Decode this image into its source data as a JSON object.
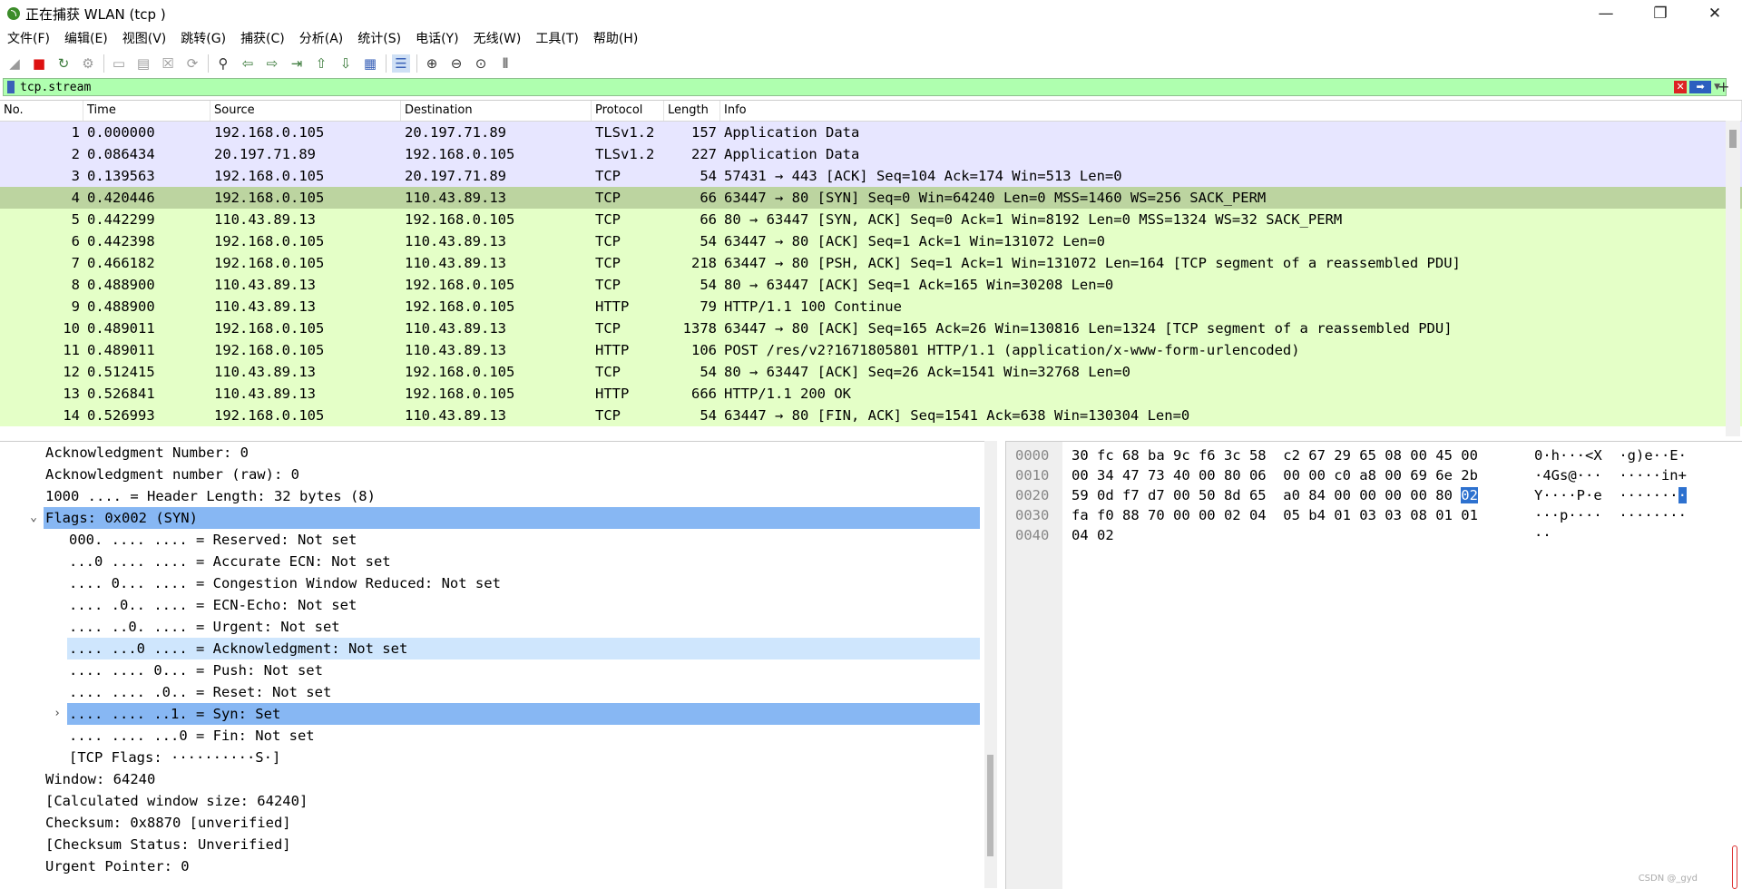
{
  "window": {
    "title": "正在捕获 WLAN (tcp )",
    "minimize_glyph": "—",
    "maximize_glyph": "❐",
    "close_glyph": "✕"
  },
  "menu": [
    "文件(F)",
    "编辑(E)",
    "视图(V)",
    "跳转(G)",
    "捕获(C)",
    "分析(A)",
    "统计(S)",
    "电话(Y)",
    "无线(W)",
    "工具(T)",
    "帮助(H)"
  ],
  "toolbar": {
    "icons": [
      "shark-fin-start-icon",
      "stop-capture-icon",
      "restart-capture-icon",
      "capture-options-icon",
      "open-file-icon",
      "save-file-icon",
      "close-file-icon",
      "reload-file-icon",
      "find-packet-icon",
      "go-back-icon",
      "go-forward-icon",
      "go-to-packet-icon",
      "go-first-icon",
      "go-last-icon",
      "auto-scroll-icon",
      "colorize-icon",
      "zoom-in-icon",
      "zoom-out-icon",
      "zoom-normal-icon",
      "resize-columns-icon"
    ]
  },
  "filter": {
    "value": "tcp.stream",
    "clear_glyph": "✕",
    "apply_glyph": "➡",
    "dropdown_glyph": "▼",
    "add_glyph": "+"
  },
  "packet_list": {
    "columns": [
      "No.",
      "Time",
      "Source",
      "Destination",
      "Protocol",
      "Length",
      "Info"
    ],
    "rows": [
      {
        "no": "1",
        "time": "0.000000",
        "src": "192.168.0.105",
        "dst": "20.197.71.89",
        "proto": "TLSv1.2",
        "len": "157",
        "info": "Application Data",
        "style": "tls"
      },
      {
        "no": "2",
        "time": "0.086434",
        "src": "20.197.71.89",
        "dst": "192.168.0.105",
        "proto": "TLSv1.2",
        "len": "227",
        "info": "Application Data",
        "style": "tls"
      },
      {
        "no": "3",
        "time": "0.139563",
        "src": "192.168.0.105",
        "dst": "20.197.71.89",
        "proto": "TCP",
        "len": "54",
        "info": "57431 → 443 [ACK] Seq=104 Ack=174 Win=513 Len=0",
        "style": "tls"
      },
      {
        "no": "4",
        "time": "0.420446",
        "src": "192.168.0.105",
        "dst": "110.43.89.13",
        "proto": "TCP",
        "len": "66",
        "info": "63447 → 80 [SYN] Seq=0 Win=64240 Len=0 MSS=1460 WS=256 SACK_PERM",
        "style": "sel"
      },
      {
        "no": "5",
        "time": "0.442299",
        "src": "110.43.89.13",
        "dst": "192.168.0.105",
        "proto": "TCP",
        "len": "66",
        "info": "80 → 63447 [SYN, ACK] Seq=0 Ack=1 Win=8192 Len=0 MSS=1324 WS=32 SACK_PERM",
        "style": "tcp"
      },
      {
        "no": "6",
        "time": "0.442398",
        "src": "192.168.0.105",
        "dst": "110.43.89.13",
        "proto": "TCP",
        "len": "54",
        "info": "63447 → 80 [ACK] Seq=1 Ack=1 Win=131072 Len=0",
        "style": "tcp"
      },
      {
        "no": "7",
        "time": "0.466182",
        "src": "192.168.0.105",
        "dst": "110.43.89.13",
        "proto": "TCP",
        "len": "218",
        "info": "63447 → 80 [PSH, ACK] Seq=1 Ack=1 Win=131072 Len=164 [TCP segment of a reassembled PDU]",
        "style": "tcp"
      },
      {
        "no": "8",
        "time": "0.488900",
        "src": "110.43.89.13",
        "dst": "192.168.0.105",
        "proto": "TCP",
        "len": "54",
        "info": "80 → 63447 [ACK] Seq=1 Ack=165 Win=30208 Len=0",
        "style": "tcp"
      },
      {
        "no": "9",
        "time": "0.488900",
        "src": "110.43.89.13",
        "dst": "192.168.0.105",
        "proto": "HTTP",
        "len": "79",
        "info": "HTTP/1.1 100 Continue",
        "style": "tcp"
      },
      {
        "no": "10",
        "time": "0.489011",
        "src": "192.168.0.105",
        "dst": "110.43.89.13",
        "proto": "TCP",
        "len": "1378",
        "info": "63447 → 80 [ACK] Seq=165 Ack=26 Win=130816 Len=1324 [TCP segment of a reassembled PDU]",
        "style": "tcp"
      },
      {
        "no": "11",
        "time": "0.489011",
        "src": "192.168.0.105",
        "dst": "110.43.89.13",
        "proto": "HTTP",
        "len": "106",
        "info": "POST /res/v2?1671805801 HTTP/1.1  (application/x-www-form-urlencoded)",
        "style": "tcp"
      },
      {
        "no": "12",
        "time": "0.512415",
        "src": "110.43.89.13",
        "dst": "192.168.0.105",
        "proto": "TCP",
        "len": "54",
        "info": "80 → 63447 [ACK] Seq=26 Ack=1541 Win=32768 Len=0",
        "style": "tcp"
      },
      {
        "no": "13",
        "time": "0.526841",
        "src": "110.43.89.13",
        "dst": "192.168.0.105",
        "proto": "HTTP",
        "len": "666",
        "info": "HTTP/1.1 200 OK",
        "style": "tcp"
      },
      {
        "no": "14",
        "time": "0.526993",
        "src": "192.168.0.105",
        "dst": "110.43.89.13",
        "proto": "TCP",
        "len": "54",
        "info": "63447 → 80 [FIN, ACK] Seq=1541 Ack=638 Win=130304 Len=0",
        "style": "tcp"
      }
    ]
  },
  "details": {
    "lines": [
      {
        "text": "Acknowledgment Number: 0",
        "indent": 0,
        "hl": ""
      },
      {
        "text": "Acknowledgment number (raw): 0",
        "indent": 0,
        "hl": ""
      },
      {
        "text": "1000 .... = Header Length: 32 bytes (8)",
        "indent": 0,
        "hl": ""
      },
      {
        "text": "Flags: 0x002 (SYN)",
        "indent": 0,
        "hl": "strong",
        "expander": "⌄"
      },
      {
        "text": "000. .... .... = Reserved: Not set",
        "indent": 1,
        "hl": ""
      },
      {
        "text": "...0 .... .... = Accurate ECN: Not set",
        "indent": 1,
        "hl": ""
      },
      {
        "text": ".... 0... .... = Congestion Window Reduced: Not set",
        "indent": 1,
        "hl": ""
      },
      {
        "text": ".... .0.. .... = ECN-Echo: Not set",
        "indent": 1,
        "hl": ""
      },
      {
        "text": ".... ..0. .... = Urgent: Not set",
        "indent": 1,
        "hl": ""
      },
      {
        "text": ".... ...0 .... = Acknowledgment: Not set",
        "indent": 1,
        "hl": "light"
      },
      {
        "text": ".... .... 0... = Push: Not set",
        "indent": 1,
        "hl": ""
      },
      {
        "text": ".... .... .0.. = Reset: Not set",
        "indent": 1,
        "hl": ""
      },
      {
        "text": ".... .... ..1. = Syn: Set",
        "indent": 1,
        "hl": "strong",
        "expander": "›"
      },
      {
        "text": ".... .... ...0 = Fin: Not set",
        "indent": 1,
        "hl": ""
      },
      {
        "text": "[TCP Flags: ··········S·]",
        "indent": 1,
        "hl": ""
      },
      {
        "text": "Window: 64240",
        "indent": 0,
        "hl": ""
      },
      {
        "text": "[Calculated window size: 64240]",
        "indent": 0,
        "hl": ""
      },
      {
        "text": "Checksum: 0x8870 [unverified]",
        "indent": 0,
        "hl": ""
      },
      {
        "text": "[Checksum Status: Unverified]",
        "indent": 0,
        "hl": ""
      },
      {
        "text": "Urgent Pointer: 0",
        "indent": 0,
        "hl": ""
      }
    ]
  },
  "bytes": {
    "rows": [
      {
        "offset": "0000",
        "hex": "30 fc 68 ba 9c f6 3c 58  c2 67 29 65 08 00 45 00",
        "ascii": "0·h···<X  ·g)e··E·"
      },
      {
        "offset": "0010",
        "hex": "00 34 47 73 40 00 80 06  00 00 c0 a8 00 69 6e 2b",
        "ascii": "·4Gs@···  ·····in+"
      },
      {
        "offset": "0020",
        "hex_pre": "59 0d f7 d7 00 50 8d 65  a0 84 00 00 00 00 80 ",
        "hex_sel": "02",
        "ascii_pre": "Y····P·e  ·······",
        "ascii_sel": "·"
      },
      {
        "offset": "0030",
        "hex": "fa f0 88 70 00 00 02 04  05 b4 01 03 03 08 01 01",
        "ascii": "···p····  ········"
      },
      {
        "offset": "0040",
        "hex": "04 02",
        "ascii": "··"
      }
    ]
  },
  "watermark": "CSDN @_gyd"
}
